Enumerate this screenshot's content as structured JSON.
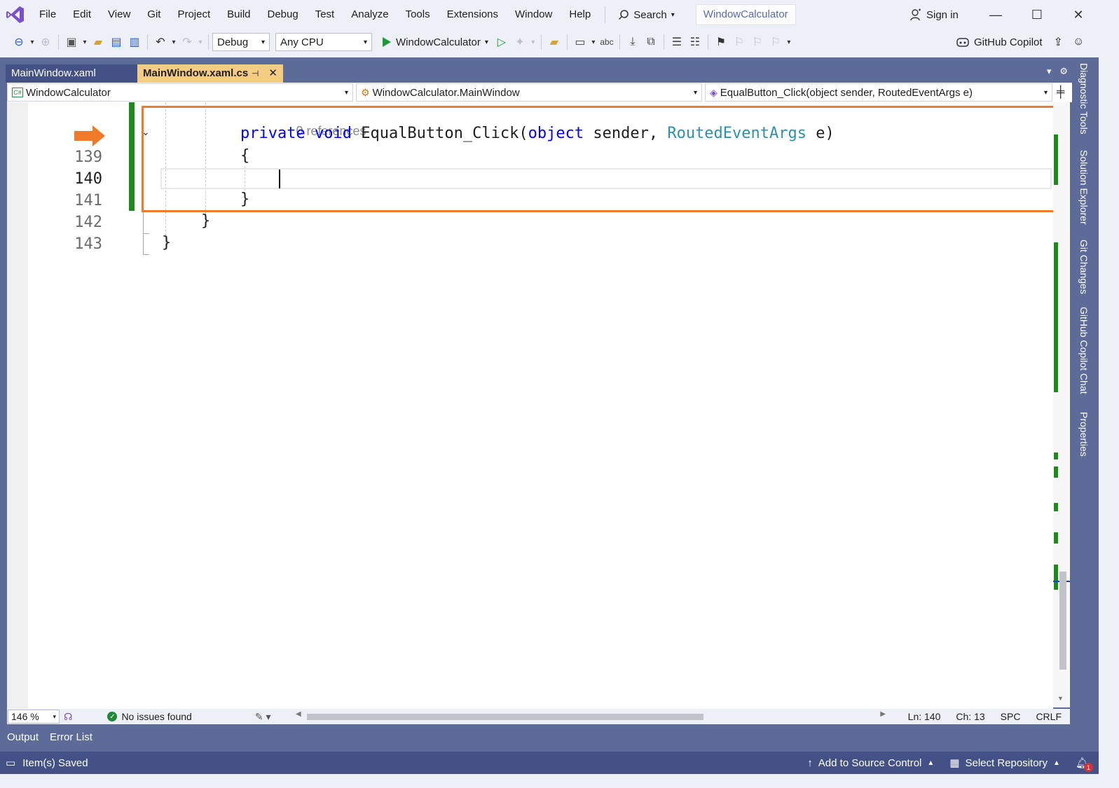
{
  "menu": {
    "items": [
      "File",
      "Edit",
      "View",
      "Git",
      "Project",
      "Build",
      "Debug",
      "Test",
      "Analyze",
      "Tools",
      "Extensions",
      "Window",
      "Help"
    ],
    "search_label": "Search",
    "solution_name": "WindowCalculator",
    "sign_in": "Sign in"
  },
  "toolbar": {
    "configuration": "Debug",
    "platform": "Any CPU",
    "run_target": "WindowCalculator",
    "copilot_label": "GitHub Copilot"
  },
  "tabs": [
    {
      "label": "MainWindow.xaml",
      "active": false
    },
    {
      "label": "MainWindow.xaml.cs",
      "active": true
    }
  ],
  "navbar": {
    "project": "WindowCalculator",
    "type": "WindowCalculator.MainWindow",
    "member": "EqualButton_Click(object sender, RoutedEventArgs e)"
  },
  "editor": {
    "references": "0 references",
    "line_numbers": [
      "139",
      "140",
      "141",
      "142",
      "143"
    ],
    "current_line": "140",
    "code": {
      "kw_private": "private",
      "kw_void": "void",
      "method": "EqualButton_Click(",
      "kw_object": "object",
      "param1": " sender, ",
      "type_args": "RoutedEventArgs",
      "param2": " e)",
      "open_brace": "{",
      "close_brace": "}",
      "close_class": "}",
      "close_ns": "}"
    },
    "highlight_color": "#ef7b2a"
  },
  "editor_status": {
    "zoom": "146 %",
    "issues": "No issues found",
    "line": "Ln: 140",
    "col": "Ch: 13",
    "whitespace": "SPC",
    "line_ending": "CRLF"
  },
  "tool_windows": [
    "Output",
    "Error List"
  ],
  "side_panel": [
    "Diagnostic Tools",
    "Solution Explorer",
    "Git Changes",
    "GitHub Copilot Chat",
    "Properties"
  ],
  "statusbar": {
    "message": "Item(s) Saved",
    "source_control": "Add to Source Control",
    "repository": "Select Repository",
    "notifications": "1"
  }
}
